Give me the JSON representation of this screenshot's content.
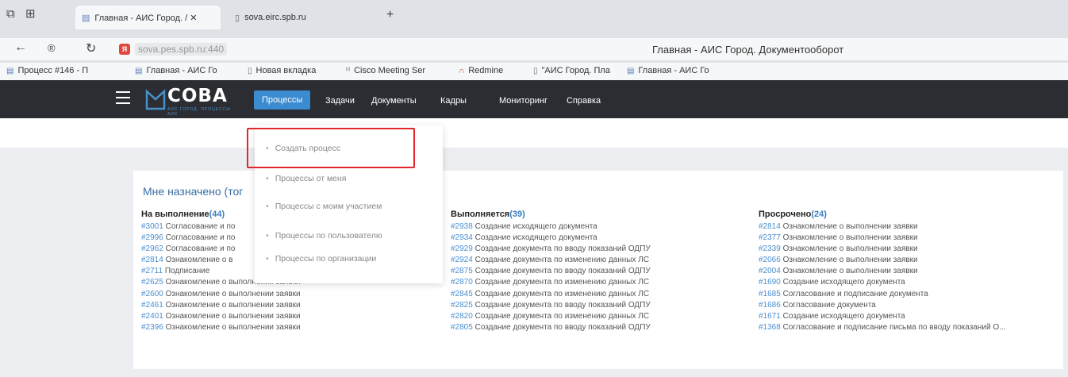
{
  "browser": {
    "tabs": [
      {
        "label": "Главная - АИС Город. / ✕"
      },
      {
        "label": "sova.eirc.spb.ru"
      }
    ],
    "url": "sova.pes.spb.ru:440",
    "window_title": "Главная - АИС Город. Документооборот",
    "bookmarks": [
      "Процесс #146 - П",
      "Главная - АИС Го",
      "Новая вкладка",
      "Cisco Meeting Ser",
      "Redmine",
      "\"АИС Город. Пла",
      "Главная - АИС Го"
    ]
  },
  "app": {
    "logo": "СОВА",
    "logo_sub": "АИС ГОРОД. ПРОЦЕССЫ АИС",
    "menu": [
      "Процессы",
      "Задачи",
      "Документы",
      "Кадры",
      "Мониторинг",
      "Справка"
    ]
  },
  "dropdown": {
    "items": [
      "Создать процесс",
      "Процессы от меня",
      "Процессы с моим участием",
      "Процессы по пользователю",
      "Процессы по организации"
    ]
  },
  "card": {
    "title": "Мне назначено (тог",
    "columns": [
      {
        "title": "На выполнение",
        "count": "(44)",
        "rows": [
          {
            "id": "#3001",
            "text": " Согласование и по"
          },
          {
            "id": "#2996",
            "text": " Согласование и по"
          },
          {
            "id": "#2962",
            "text": " Согласование и по"
          },
          {
            "id": "#2814",
            "text": " Ознакомление о в"
          },
          {
            "id": "#2711",
            "text": " Подписание"
          },
          {
            "id": "#2625",
            "text": " Ознакомление о выполнении заявки"
          },
          {
            "id": "#2600",
            "text": " Ознакомление о выполнении заявки"
          },
          {
            "id": "#2461",
            "text": " Ознакомление о выполнении заявки"
          },
          {
            "id": "#2401",
            "text": " Ознакомление о выполнении заявки"
          },
          {
            "id": "#2396",
            "text": " Ознакомление о выполнении заявки"
          }
        ]
      },
      {
        "title": "Выполняется",
        "count": "(39)",
        "rows": [
          {
            "id": "#2938",
            "text": " Создание исходящего документа"
          },
          {
            "id": "#2934",
            "text": " Создание исходящего документа"
          },
          {
            "id": "#2929",
            "text": " Создание документа по вводу показаний ОДПУ"
          },
          {
            "id": "#2924",
            "text": " Создание документа по изменению данных ЛС"
          },
          {
            "id": "#2875",
            "text": " Создание документа по вводу показаний ОДПУ"
          },
          {
            "id": "#2870",
            "text": " Создание документа по изменению данных ЛС"
          },
          {
            "id": "#2845",
            "text": " Создание документа по изменению данных ЛС"
          },
          {
            "id": "#2825",
            "text": " Создание документа по вводу показаний ОДПУ"
          },
          {
            "id": "#2820",
            "text": " Создание документа по изменению данных ЛС"
          },
          {
            "id": "#2805",
            "text": " Создание документа по вводу показаний ОДПУ"
          }
        ]
      },
      {
        "title": "Просрочено",
        "count": "(24)",
        "rows": [
          {
            "id": "#2814",
            "text": " Ознакомление о выполнении заявки"
          },
          {
            "id": "#2377",
            "text": " Ознакомление о выполнении заявки"
          },
          {
            "id": "#2339",
            "text": " Ознакомление о выполнении заявки"
          },
          {
            "id": "#2066",
            "text": " Ознакомление о выполнении заявки"
          },
          {
            "id": "#2004",
            "text": " Ознакомление о выполнении заявки"
          },
          {
            "id": "#1690",
            "text": " Создание исходящего документа"
          },
          {
            "id": "#1685",
            "text": " Согласование и подписание документа"
          },
          {
            "id": "#1686",
            "text": " Согласование документа"
          },
          {
            "id": "#1671",
            "text": " Создание исходящего документа"
          },
          {
            "id": "#1368",
            "text": " Согласование и подписание письма по вводу показаний О..."
          }
        ]
      }
    ]
  },
  "colors": {
    "appbar": "#2b2d33",
    "active_menu": "#3b8bd0",
    "highlight": "#e3262b",
    "link": "#4a8fd0"
  }
}
